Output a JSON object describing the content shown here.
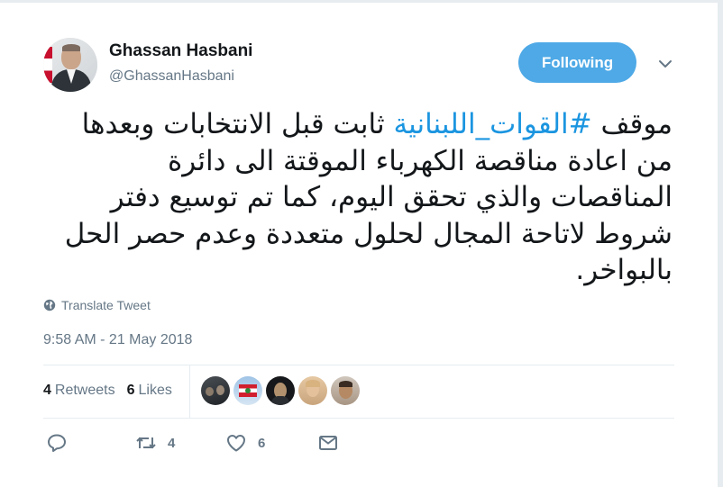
{
  "author": {
    "display_name": "Ghassan Hasbani",
    "handle": "@GhassanHasbani"
  },
  "follow_button": {
    "label": "Following"
  },
  "tweet": {
    "hashtag": "#القوات_اللبنانية",
    "text_before": "موقف ",
    "text_after": " ثابت قبل الانتخابات وبعدها من اعادة مناقصة الكهرباء الموقتة الى دائرة المناقصات والذي تحقق اليوم، كما تم توسيع دفتر شروط لاتاحة المجال لحلول متعددة وعدم حصر الحل بالبواخر."
  },
  "translate": {
    "label": "Translate Tweet"
  },
  "timestamp": "9:58 AM - 21 May 2018",
  "stats": {
    "retweets_count": "4",
    "retweets_label": "Retweets",
    "likes_count": "6",
    "likes_label": "Likes"
  },
  "actions": {
    "retweet_count": "4",
    "like_count": "6"
  },
  "colors": {
    "accent": "#1b95e0",
    "follow_bg": "#4ea9e6",
    "muted": "#657786"
  }
}
